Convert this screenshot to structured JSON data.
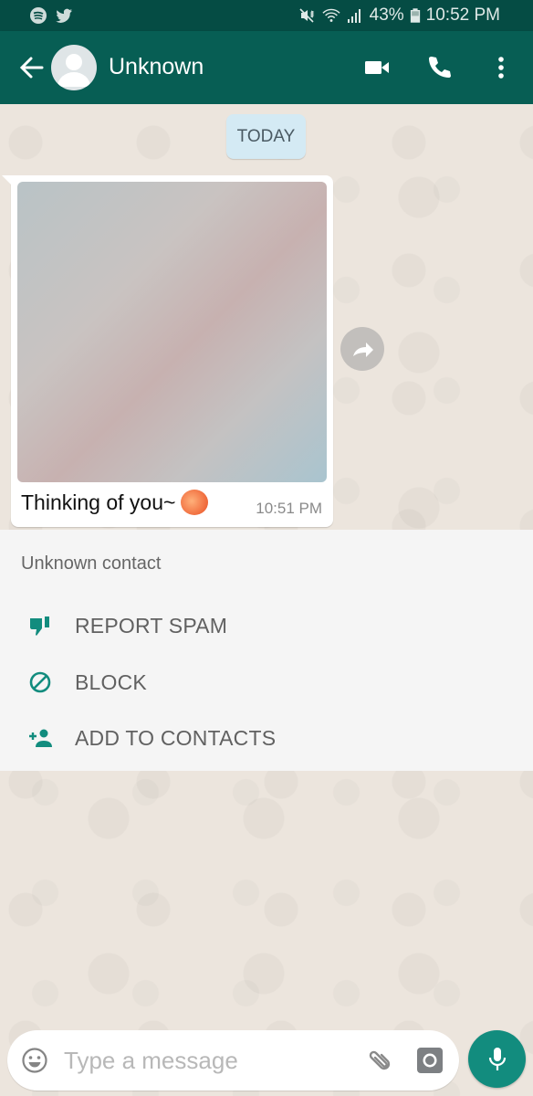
{
  "status_bar": {
    "notification_icons": [
      "spotify-icon",
      "twitter-icon"
    ],
    "system_icons": [
      "mute-vibrate-icon",
      "wifi-icon",
      "signal-icon",
      "battery-icon"
    ],
    "battery": "43%",
    "time": "10:52 PM"
  },
  "app_bar": {
    "back_icon": "arrow-left-icon",
    "avatar_icon": "default-avatar-icon",
    "contact_name": "Unknown",
    "actions": [
      "video-call-icon",
      "voice-call-icon",
      "more-vert-icon"
    ]
  },
  "chat": {
    "date_chip": "TODAY",
    "messages": [
      {
        "type": "image",
        "caption": "Thinking of you~",
        "emoji": "peach",
        "time": "10:51 PM",
        "incoming": true
      }
    ],
    "forward_icon": "forward-arrow-icon"
  },
  "unknown_contact_panel": {
    "title": "Unknown contact",
    "actions": [
      {
        "icon": "thumb-down-icon",
        "label": "REPORT SPAM"
      },
      {
        "icon": "block-icon",
        "label": "BLOCK"
      },
      {
        "icon": "person-add-icon",
        "label": "ADD TO CONTACTS"
      }
    ]
  },
  "composer": {
    "placeholder": "Type a message",
    "value": "",
    "icons": [
      "emoji-icon",
      "paperclip-icon",
      "camera-icon",
      "mic-icon"
    ]
  },
  "colors": {
    "status_bar": "#054c44",
    "app_bar": "#075e54",
    "accent": "#128c7e",
    "chat_background": "#ece5dd",
    "date_chip": "#d4eaf4",
    "panel_background": "#f5f5f5"
  }
}
